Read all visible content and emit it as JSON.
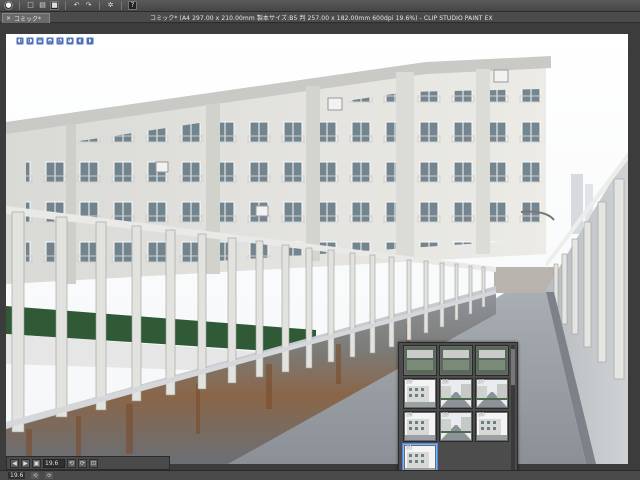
{
  "toolbar": {
    "icons": [
      "app-logo-icon",
      "new-file-icon",
      "open-folder-icon",
      "save-icon",
      "undo-icon",
      "redo-icon",
      "settings-icon",
      "help-icon"
    ],
    "glyphs": [
      "●",
      "□",
      "▤",
      "■",
      "↶",
      "↷",
      "✲",
      "?"
    ]
  },
  "tab": {
    "close_glyph": "×",
    "label": "コミック*"
  },
  "window": {
    "title": "コミック* (A4 297.00 x 210.00mm 製本サイズ:B5 判 257.00 x 182.00mm 600dpi 19.6%) - CLIP STUDIO PAINT EX"
  },
  "mini_palette": {
    "glyphs": [
      "◐",
      "◑",
      "◒",
      "◓",
      "◔",
      "◕",
      "◖",
      "◗"
    ]
  },
  "navigator": {
    "glyphs": [
      "◀",
      "▶",
      "▣"
    ],
    "zoom": "19.6",
    "extra_glyphs": [
      "⟲",
      "⟳",
      "⊡"
    ]
  },
  "page_manager": {
    "pages": [
      {
        "number": "",
        "thumb": "exterior"
      },
      {
        "number": "",
        "thumb": "exterior"
      },
      {
        "number": "",
        "thumb": "exterior"
      },
      {
        "number": "25",
        "thumb": "building"
      },
      {
        "number": "26",
        "thumb": "street"
      },
      {
        "number": "27",
        "thumb": "street"
      },
      {
        "number": "28",
        "thumb": "building"
      },
      {
        "number": "29",
        "thumb": "street"
      },
      {
        "number": "30",
        "thumb": "building"
      },
      {
        "number": "31",
        "thumb": "building",
        "selected": true
      }
    ]
  },
  "colors": {
    "accent": "#4a8ae0",
    "ui_bg": "#4a4a4a",
    "sky": "#ffffff"
  }
}
